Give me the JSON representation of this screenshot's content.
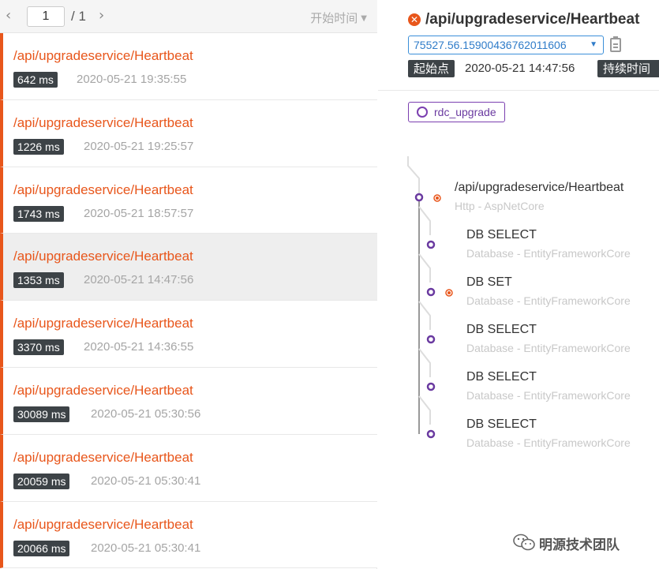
{
  "pager": {
    "prev_icon": "chevron-left",
    "page": "1",
    "total": "/ 1",
    "next_icon": "chevron-right",
    "sort_label": "开始时间",
    "sort_caret": "▼"
  },
  "traces": [
    {
      "title": "/api/upgradeservice/Heartbeat",
      "duration": "642 ms",
      "time": "2020-05-21 19:35:55"
    },
    {
      "title": "/api/upgradeservice/Heartbeat",
      "duration": "1226 ms",
      "time": "2020-05-21 19:25:57"
    },
    {
      "title": "/api/upgradeservice/Heartbeat",
      "duration": "1743 ms",
      "time": "2020-05-21 18:57:57"
    },
    {
      "title": "/api/upgradeservice/Heartbeat",
      "duration": "1353 ms",
      "time": "2020-05-21 14:47:56"
    },
    {
      "title": "/api/upgradeservice/Heartbeat",
      "duration": "3370 ms",
      "time": "2020-05-21 14:36:55"
    },
    {
      "title": "/api/upgradeservice/Heartbeat",
      "duration": "30089 ms",
      "time": "2020-05-21 05:30:56"
    },
    {
      "title": "/api/upgradeservice/Heartbeat",
      "duration": "20059 ms",
      "time": "2020-05-21 05:30:41"
    },
    {
      "title": "/api/upgradeservice/Heartbeat",
      "duration": "20066 ms",
      "time": "2020-05-21 05:30:41"
    }
  ],
  "detail": {
    "error_icon": "✕",
    "title": "/api/upgradeservice/Heartbeat",
    "trace_id": "75527.56.15900436762011606",
    "trace_caret": "▼",
    "start_label": "起始点",
    "start_time": "2020-05-21 14:47:56",
    "duration_label": "持续时间",
    "service": "rdc_upgrade",
    "spans": [
      {
        "name": "/api/upgradeservice/Heartbeat",
        "component": "Http - AspNetCore",
        "error": true
      },
      {
        "name": "DB SELECT",
        "component": "Database - EntityFrameworkCore",
        "error": false
      },
      {
        "name": "DB SET",
        "component": "Database - EntityFrameworkCore",
        "error": true
      },
      {
        "name": "DB SELECT",
        "component": "Database - EntityFrameworkCore",
        "error": false
      },
      {
        "name": "DB SELECT",
        "component": "Database - EntityFrameworkCore",
        "error": false
      },
      {
        "name": "DB SELECT",
        "component": "Database - EntityFrameworkCore",
        "error": false
      }
    ]
  },
  "watermark": "明源技术团队",
  "colors": {
    "accent_error": "#e8561b",
    "badge_bg": "#3d4347",
    "service_purple": "#7b3fb0",
    "select_blue": "#3b8fd9",
    "selected_row_bg": "#eeeeee"
  }
}
